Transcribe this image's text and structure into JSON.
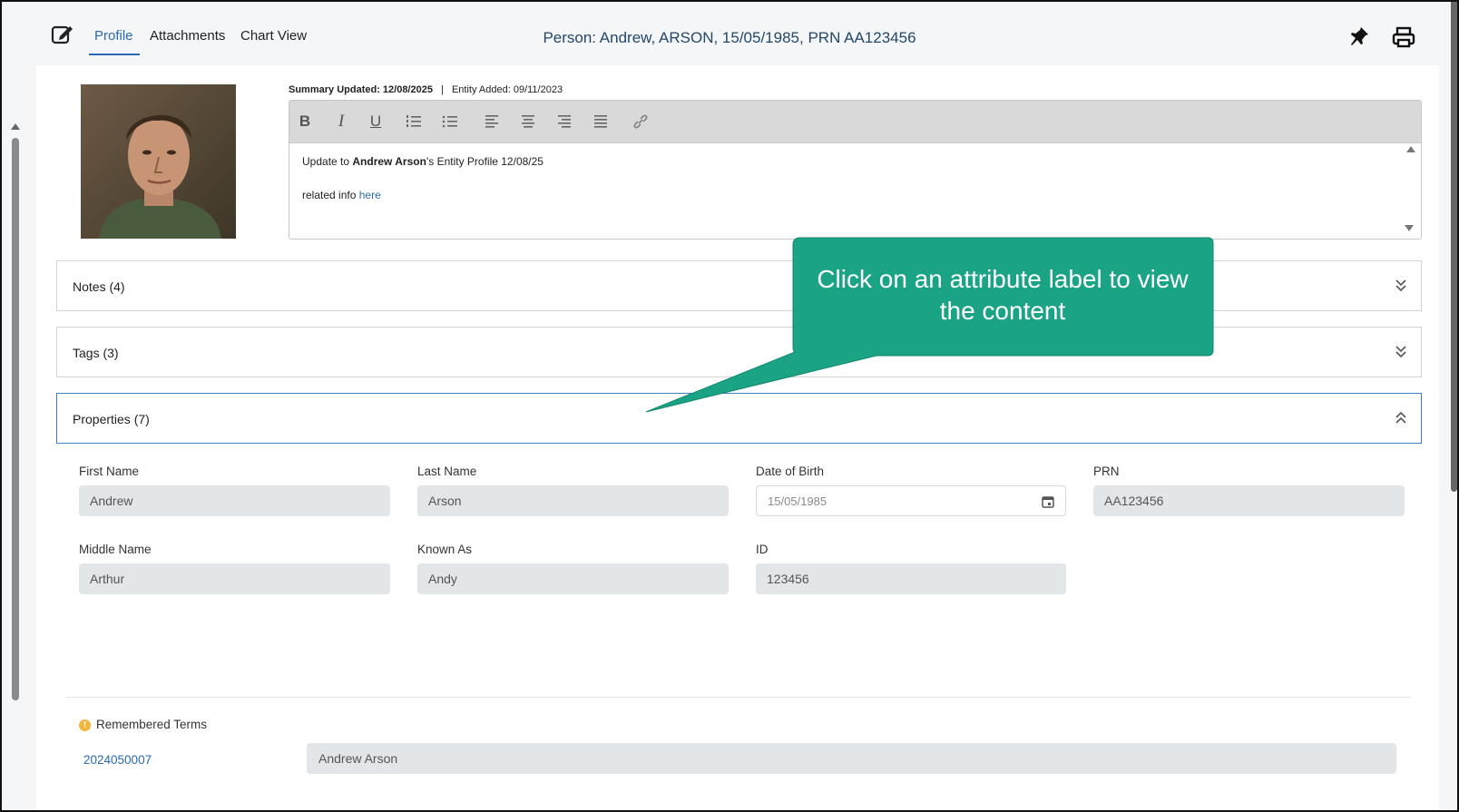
{
  "header": {
    "tabs": [
      {
        "label": "Profile",
        "active": true
      },
      {
        "label": "Attachments",
        "active": false
      },
      {
        "label": "Chart View",
        "active": false
      }
    ],
    "title": "Person: Andrew, ARSON, 15/05/1985, PRN AA123456"
  },
  "summary": {
    "updated_label": "Summary Updated: 12/08/2025",
    "separator": "|",
    "added_label": "Entity Added: 09/11/2023",
    "toolbar": [
      "B",
      "I",
      "U",
      "ordered-list",
      "bullet-list",
      "align-left",
      "align-center",
      "align-right",
      "justify",
      "link"
    ],
    "line1_prefix": "Update to ",
    "line1_bold": "Andrew Arson",
    "line1_suffix": "'s Entity Profile 12/08/25",
    "line2_prefix": "related info ",
    "line2_link": "here"
  },
  "panels": {
    "notes": "Notes (4)",
    "tags": "Tags (3)",
    "properties": "Properties (7)"
  },
  "properties": {
    "first_name": {
      "label": "First Name",
      "value": "Andrew"
    },
    "last_name": {
      "label": "Last Name",
      "value": "Arson"
    },
    "dob": {
      "label": "Date of Birth",
      "value": "15/05/1985"
    },
    "prn": {
      "label": "PRN",
      "value": "AA123456"
    },
    "middle_name": {
      "label": "Middle Name",
      "value": "Arthur"
    },
    "known_as": {
      "label": "Known As",
      "value": "Andy"
    },
    "id": {
      "label": "ID",
      "value": "123456"
    }
  },
  "remembered_terms": {
    "label": "Remembered Terms",
    "term_id": "2024050007",
    "term_value": "Andrew Arson"
  },
  "callout": {
    "text": "Click on an attribute label to view the content",
    "color": "#1aa384"
  },
  "colors": {
    "accent": "#2a6ab3",
    "title": "#24476b"
  }
}
